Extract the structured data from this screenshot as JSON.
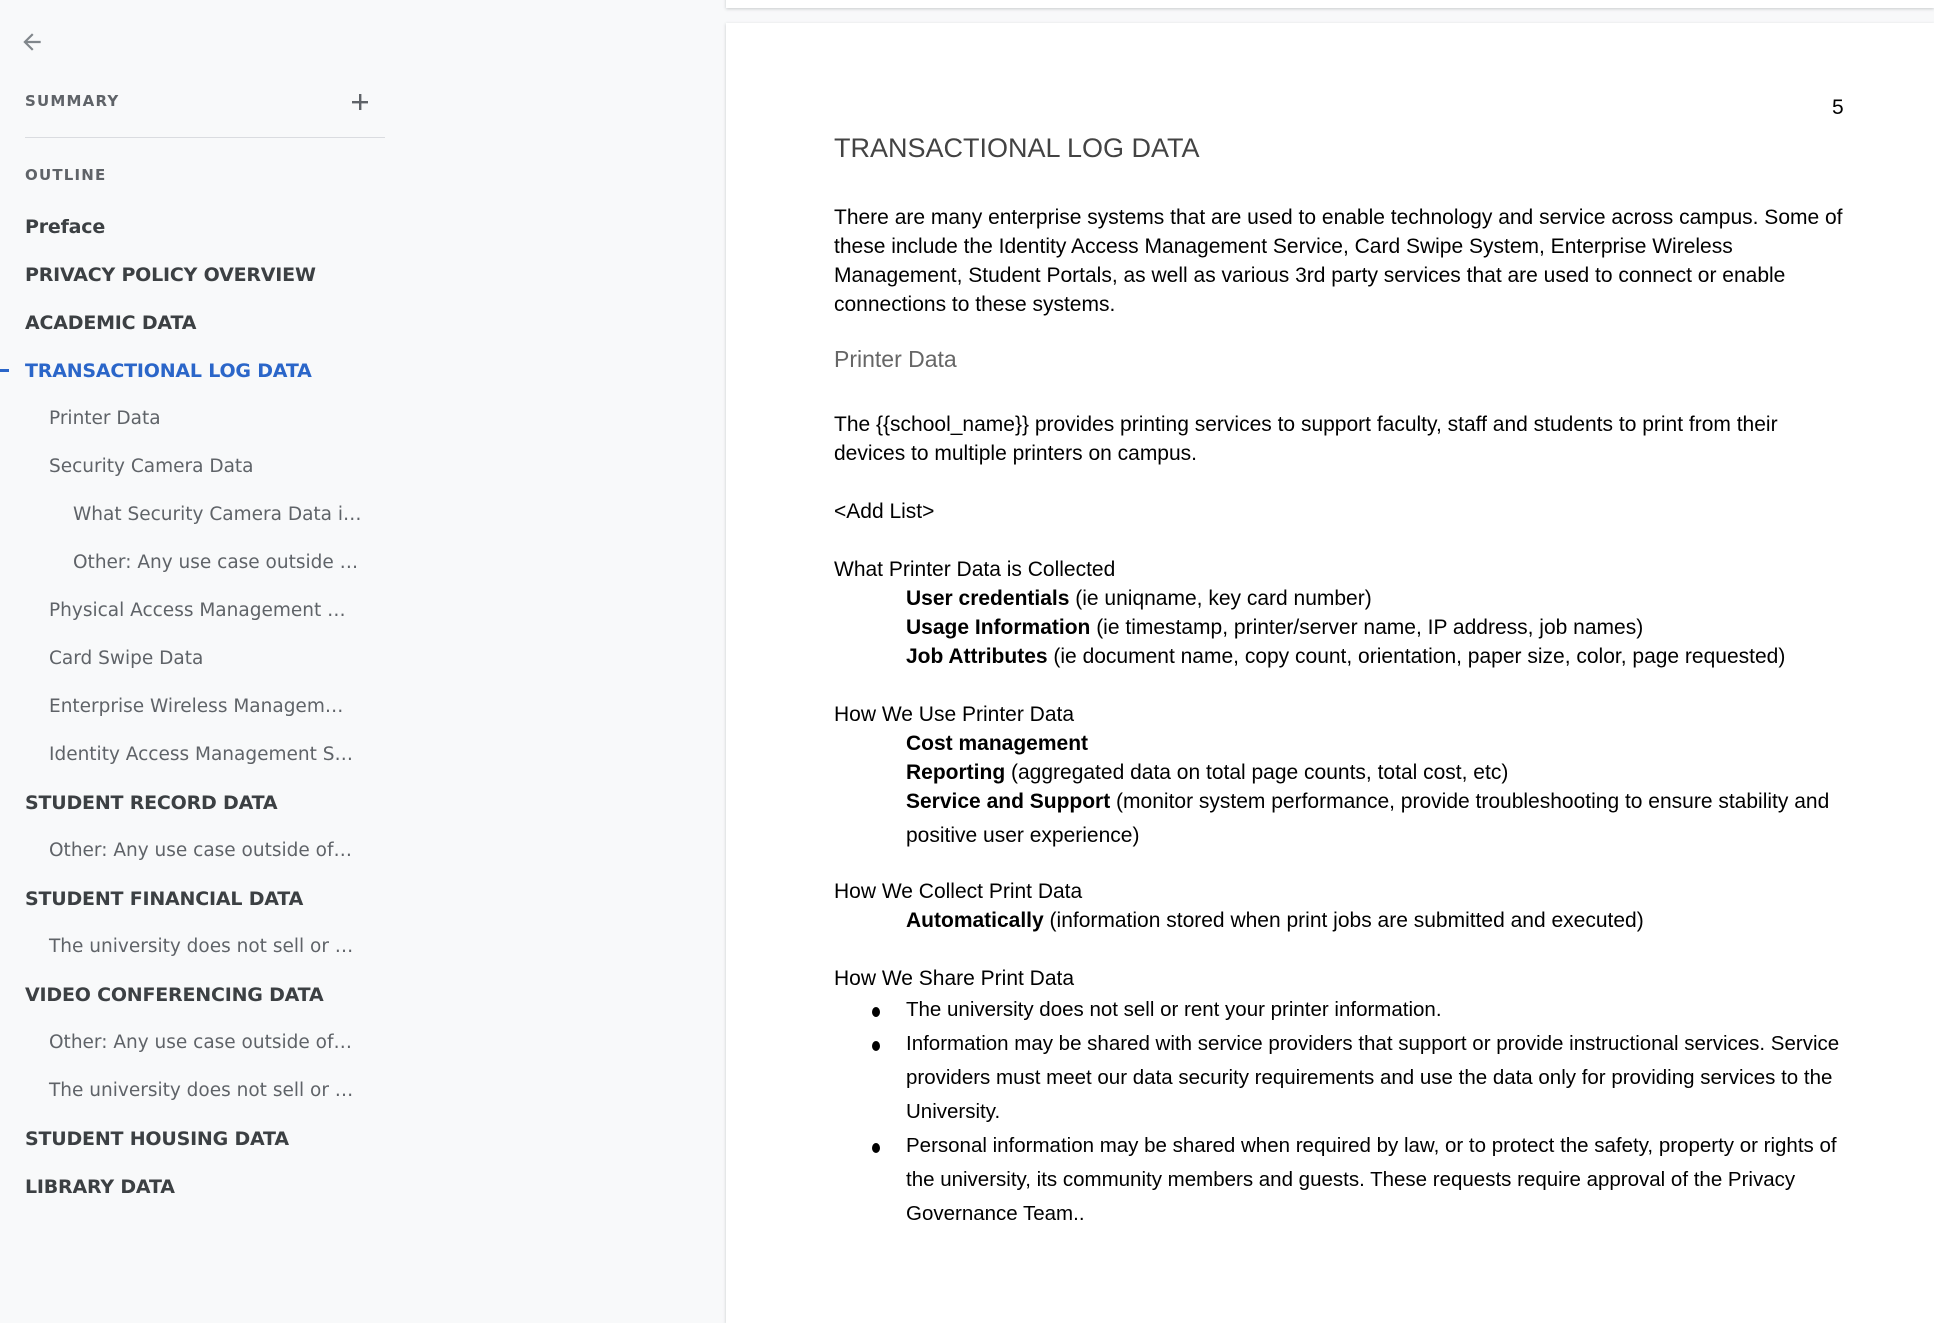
{
  "sidebar": {
    "back_icon": "arrow-left-icon",
    "summary_label": "SUMMARY",
    "add_summary_icon": "plus-icon",
    "outline_label": "OUTLINE",
    "accent_color": "#2b66c9",
    "items": [
      {
        "label": "Preface",
        "level": 1,
        "active": false
      },
      {
        "label": "PRIVACY POLICY OVERVIEW",
        "level": 1,
        "active": false
      },
      {
        "label": "ACADEMIC DATA",
        "level": 1,
        "active": false
      },
      {
        "label": "TRANSACTIONAL LOG DATA",
        "level": 1,
        "active": true
      },
      {
        "label": "Printer Data",
        "level": 2,
        "active": false
      },
      {
        "label": "Security Camera Data",
        "level": 2,
        "active": false
      },
      {
        "label": "What Security Camera Data i…",
        "level": 3,
        "active": false
      },
      {
        "label": "Other: Any use case outside …",
        "level": 3,
        "active": false
      },
      {
        "label": "Physical Access Management …",
        "level": 2,
        "active": false
      },
      {
        "label": "Card Swipe Data",
        "level": 2,
        "active": false
      },
      {
        "label": "Enterprise Wireless Managem…",
        "level": 2,
        "active": false
      },
      {
        "label": "Identity Access Management S…",
        "level": 2,
        "active": false
      },
      {
        "label": "STUDENT RECORD DATA",
        "level": 1,
        "active": false
      },
      {
        "label": "Other: Any use case outside of…",
        "level": 2,
        "active": false
      },
      {
        "label": "STUDENT FINANCIAL DATA",
        "level": 1,
        "active": false
      },
      {
        "label": "The university does not sell or …",
        "level": 2,
        "active": false
      },
      {
        "label": "VIDEO CONFERENCING DATA",
        "level": 1,
        "active": false
      },
      {
        "label": "Other: Any use case outside of…",
        "level": 2,
        "active": false
      },
      {
        "label": "The university does not sell or …",
        "level": 2,
        "active": false
      },
      {
        "label": "STUDENT HOUSING DATA",
        "level": 1,
        "active": false
      },
      {
        "label": "LIBRARY DATA",
        "level": 1,
        "active": false
      }
    ]
  },
  "document": {
    "page_number": "5",
    "title": "TRANSACTIONAL LOG DATA",
    "intro": "There are many enterprise systems that are used to enable technology and service across campus. Some of these include the Identity Access Management Service, Card Swipe System, Enterprise Wireless Management, Student Portals, as well as various 3rd party services that are used to connect or enable connections to these systems.",
    "subheading": "Printer Data",
    "printer_intro": "The {{school_name}} provides printing services to support faculty, staff and students to print from their devices to multiple printers on campus.",
    "add_list": "<Add List>",
    "collected": {
      "heading": "What Printer Data is Collected",
      "items": [
        {
          "bold": "User credentials",
          "text": " (ie uniqname, key card number)"
        },
        {
          "bold": "Usage Information",
          "text": " (ie timestamp, printer/server name, IP address, job names)"
        },
        {
          "bold": "Job Attributes",
          "text": " (ie document name, copy count, orientation, paper size, color, page requested)"
        }
      ]
    },
    "use": {
      "heading": "How We Use Printer Data",
      "items": [
        {
          "bold": "Cost management",
          "text": ""
        },
        {
          "bold": "Reporting",
          "text": " (aggregated data on total page counts, total cost, etc)"
        },
        {
          "bold": "Service and Support",
          "text": " (monitor system performance, provide troubleshooting to ensure stability and positive user experience)"
        }
      ]
    },
    "collect": {
      "heading": "How We Collect Print Data",
      "items": [
        {
          "bold": "Automatically",
          "text": " (information stored when print jobs are submitted and executed)"
        }
      ]
    },
    "share": {
      "heading": "How We Share Print Data",
      "bullets": [
        "The university does not sell or rent your printer information.",
        "Information may be shared with service providers that support or provide instructional services. Service providers must meet our data security requirements and use the data only for providing services to the University.",
        "Personal information may be shared when required by law, or to protect the safety, property or rights of the university, its community members and guests. These requests require approval of the Privacy Governance Team.."
      ]
    }
  }
}
